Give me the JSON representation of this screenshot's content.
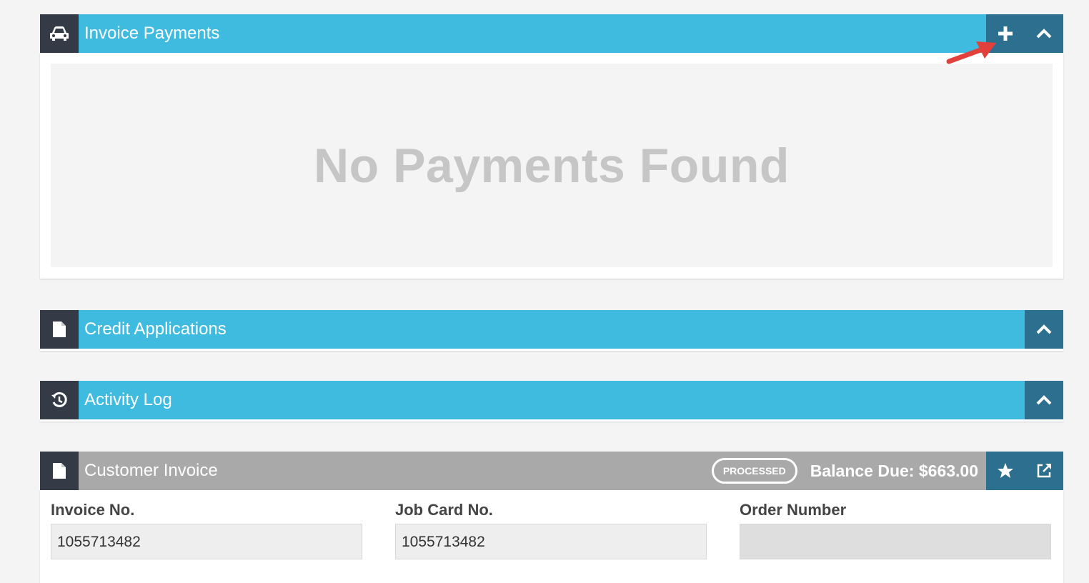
{
  "invoice_payments": {
    "title": "Invoice Payments",
    "icon": "car-icon",
    "empty_message": "No Payments Found"
  },
  "credit_applications": {
    "title": "Credit Applications",
    "icon": "document-icon"
  },
  "activity_log": {
    "title": "Activity Log",
    "icon": "history-icon"
  },
  "customer_invoice": {
    "title": "Customer Invoice",
    "icon": "document-icon",
    "status_badge": "PROCESSED",
    "balance_due": "Balance Due: $663.00",
    "fields": [
      {
        "label": "Invoice No.",
        "value": "1055713482"
      },
      {
        "label": "Job Card No.",
        "value": "1055713482"
      },
      {
        "label": "Order Number",
        "value": ""
      }
    ]
  },
  "colors": {
    "header_blue": "#3fbbe0",
    "header_gray": "#a9a9a9",
    "icon_bg": "#343a46",
    "button_bg": "#2d6f8f",
    "annotation_arrow": "#e2403b"
  }
}
